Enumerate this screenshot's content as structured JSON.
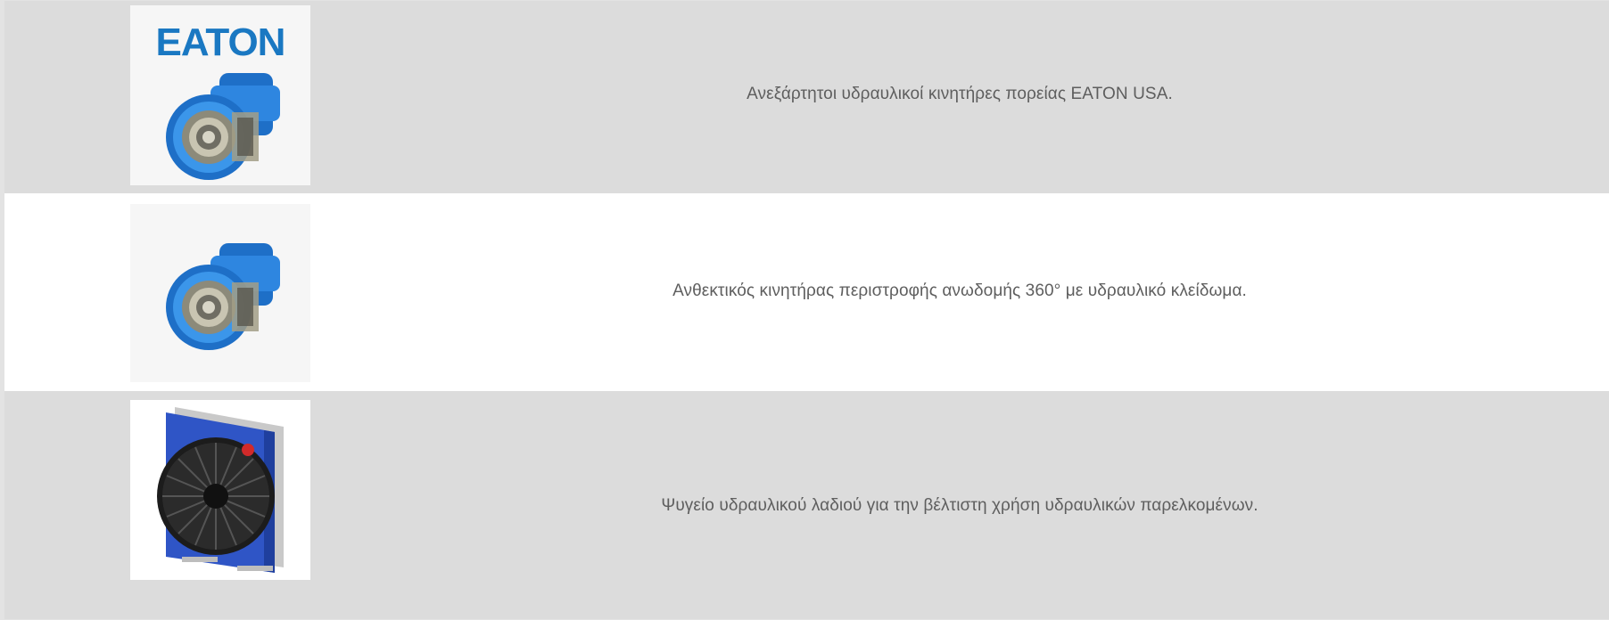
{
  "products": [
    {
      "image": "eaton-hydraulic-drive-motor-with-logo",
      "logo_text": "EATON",
      "description": "Ανεξάρτητοι υδραυλικοί κινητήρες πορείας EATON USA."
    },
    {
      "image": "slew-drive-hydraulic-motor",
      "description": "Ανθεκτικός κινητήρας περιστροφής ανωδομής 360° με υδραυλικό κλείδωμα."
    },
    {
      "image": "hydraulic-oil-cooler-with-fan",
      "description": "Ψυγείο υδραυλικού λαδιού για την βέλτιστη χρήση υδραυλικών παρελκομένων."
    }
  ],
  "colors": {
    "row_grey": "#dcdcdc",
    "row_white": "#ffffff",
    "text": "#5e5e5e",
    "eaton_blue": "#1a78c2",
    "motor_blue": "#1e6fc7",
    "cooler_blue": "#2f55c6"
  }
}
